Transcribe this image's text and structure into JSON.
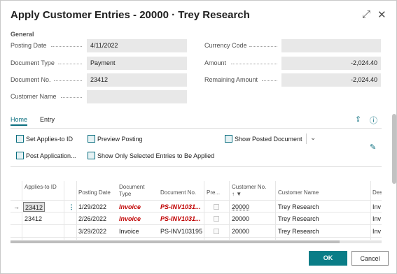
{
  "window": {
    "title": "Apply Customer Entries - 20000 · Trey Research",
    "expand_icon": "expand-icon",
    "close_icon": "close-icon"
  },
  "general": {
    "section_label": "General",
    "posting_date_label": "Posting Date",
    "posting_date_value": "4/11/2022",
    "document_type_label": "Document Type",
    "document_type_value": "Payment",
    "document_no_label": "Document No.",
    "document_no_value": "23412",
    "customer_name_label": "Customer Name",
    "customer_name_value": "",
    "currency_code_label": "Currency Code",
    "currency_code_value": "",
    "amount_label": "Amount",
    "amount_value": "-2,024.40",
    "remaining_amount_label": "Remaining Amount",
    "remaining_amount_value": "-2,024.40"
  },
  "tabs": [
    {
      "label": "Home",
      "active": true
    },
    {
      "label": "Entry",
      "active": false
    }
  ],
  "actions": {
    "set_applies_to_id": "Set Applies-to ID",
    "preview_posting": "Preview Posting",
    "show_posted_document": "Show Posted Document",
    "post_application": "Post Application...",
    "show_only_selected": "Show Only Selected Entries to Be Applied"
  },
  "grid": {
    "columns": {
      "applies_to_id": "Applies-to ID",
      "posting_date": "Posting Date",
      "document_type": "Document Type",
      "document_no": "Document No.",
      "pre": "Pre...",
      "customer_no": "Customer No.",
      "customer_name": "Customer Name",
      "des": "Des"
    },
    "rows": [
      {
        "applies_to_id": "23412",
        "posting_date": "1/29/2022",
        "document_type": "Invoice",
        "document_no": "PS-INV1031...",
        "customer_no": "20000",
        "customer_name": "Trey Research",
        "des": "Inv"
      },
      {
        "applies_to_id": "23412",
        "posting_date": "2/26/2022",
        "document_type": "Invoice",
        "document_no": "PS-INV1031...",
        "customer_no": "20000",
        "customer_name": "Trey Research",
        "des": "Inv"
      },
      {
        "applies_to_id": "",
        "posting_date": "3/29/2022",
        "document_type": "Invoice",
        "document_no": "PS-INV103195",
        "customer_no": "20000",
        "customer_name": "Trey Research",
        "des": "Inv"
      }
    ]
  },
  "buttons": {
    "ok": "OK",
    "cancel": "Cancel"
  },
  "colors": {
    "accent": "#0a7d87",
    "overdue_red": "#c00000"
  }
}
